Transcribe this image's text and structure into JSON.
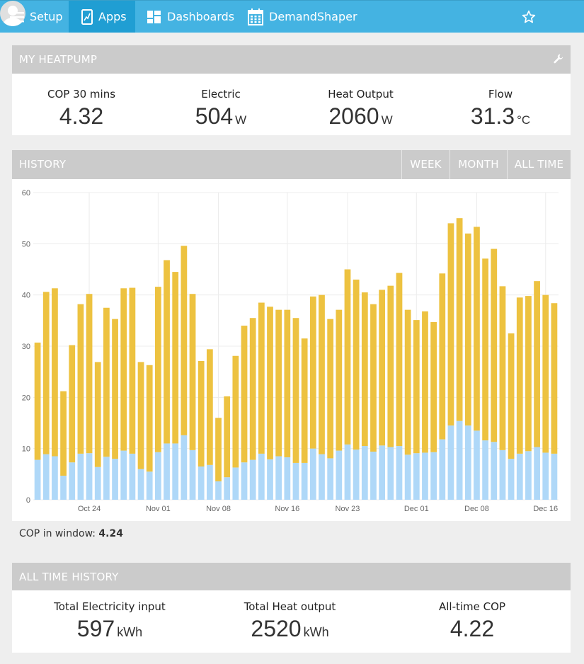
{
  "nav": {
    "setup": "Setup",
    "apps": "Apps",
    "dashboards": "Dashboards",
    "demandshaper": "DemandShaper"
  },
  "heatpump": {
    "title": "MY HEATPUMP",
    "stats": [
      {
        "label": "COP 30 mins",
        "value": "4.32",
        "unit": ""
      },
      {
        "label": "Electric",
        "value": "504",
        "unit": "W"
      },
      {
        "label": "Heat Output",
        "value": "2060",
        "unit": "W"
      },
      {
        "label": "Flow",
        "value": "31.3",
        "unit": "°C"
      }
    ]
  },
  "history": {
    "title": "HISTORY",
    "buttons": {
      "week": "WEEK",
      "month": "MONTH",
      "all": "ALL TIME"
    },
    "cop_window_label": "COP in window:",
    "cop_window_value": "4.24"
  },
  "all_time": {
    "title": "ALL TIME HISTORY",
    "stats": [
      {
        "label": "Total Electricity input",
        "value": "597",
        "unit": "kWh"
      },
      {
        "label": "Total Heat output",
        "value": "2520",
        "unit": "kWh"
      },
      {
        "label": "All-time COP",
        "value": "4.22",
        "unit": ""
      }
    ]
  },
  "colors": {
    "nav": "#44b3e2",
    "nav_active": "#209ed3",
    "heat": "#edc240",
    "elec": "#afd8f8",
    "panel_header": "#cbcbcb"
  },
  "chart_data": {
    "type": "bar",
    "stacked": true,
    "ylim": [
      0,
      60
    ],
    "yticks": [
      0,
      10,
      20,
      30,
      40,
      50,
      60
    ],
    "xticks": [
      "Oct 24",
      "Nov 01",
      "Nov 08",
      "Nov 16",
      "Nov 23",
      "Dec 01",
      "Dec 08",
      "Dec 16"
    ],
    "xtick_index": [
      6,
      14,
      21,
      29,
      36,
      44,
      51,
      59
    ],
    "series": [
      {
        "values": [
          7.8,
          8.9,
          8.5,
          4.7,
          7.3,
          9.0,
          9.1,
          6.4,
          8.4,
          8.0,
          9.6,
          9.0,
          6.0,
          5.5,
          9.3,
          11.0,
          11.0,
          12.6,
          9.7,
          6.5,
          6.8,
          3.6,
          4.4,
          6.3,
          7.3,
          7.8,
          9.0,
          7.9,
          8.5,
          8.3,
          7.2,
          7.2,
          10.0,
          8.9,
          8.1,
          9.6,
          10.8,
          9.8,
          10.5,
          9.4,
          10.6,
          10.3,
          10.5,
          8.8,
          9.1,
          9.2,
          9.3,
          11.8,
          14.5,
          15.4,
          14.5,
          13.5,
          11.6,
          11.3,
          9.7,
          8.0,
          9.0,
          9.5,
          10.3,
          9.2,
          9.0
        ]
      },
      {
        "values": [
          22.9,
          31.7,
          32.8,
          16.5,
          22.9,
          29.2,
          31.1,
          20.5,
          29.1,
          27.3,
          31.7,
          32.4,
          20.9,
          20.8,
          32.3,
          35.8,
          33.5,
          37.0,
          30.5,
          20.6,
          22.6,
          12.4,
          15.8,
          21.8,
          26.7,
          27.7,
          29.5,
          29.8,
          28.6,
          28.8,
          28.3,
          24.3,
          29.7,
          31.1,
          27.2,
          27.5,
          34.2,
          33.2,
          30.0,
          28.8,
          30.4,
          31.5,
          33.8,
          28.3,
          26.0,
          27.6,
          25.4,
          32.4,
          39.5,
          39.6,
          37.5,
          39.8,
          35.5,
          37.7,
          32.0,
          24.5,
          30.5,
          30.3,
          32.4,
          30.8,
          29.4
        ]
      }
    ]
  }
}
